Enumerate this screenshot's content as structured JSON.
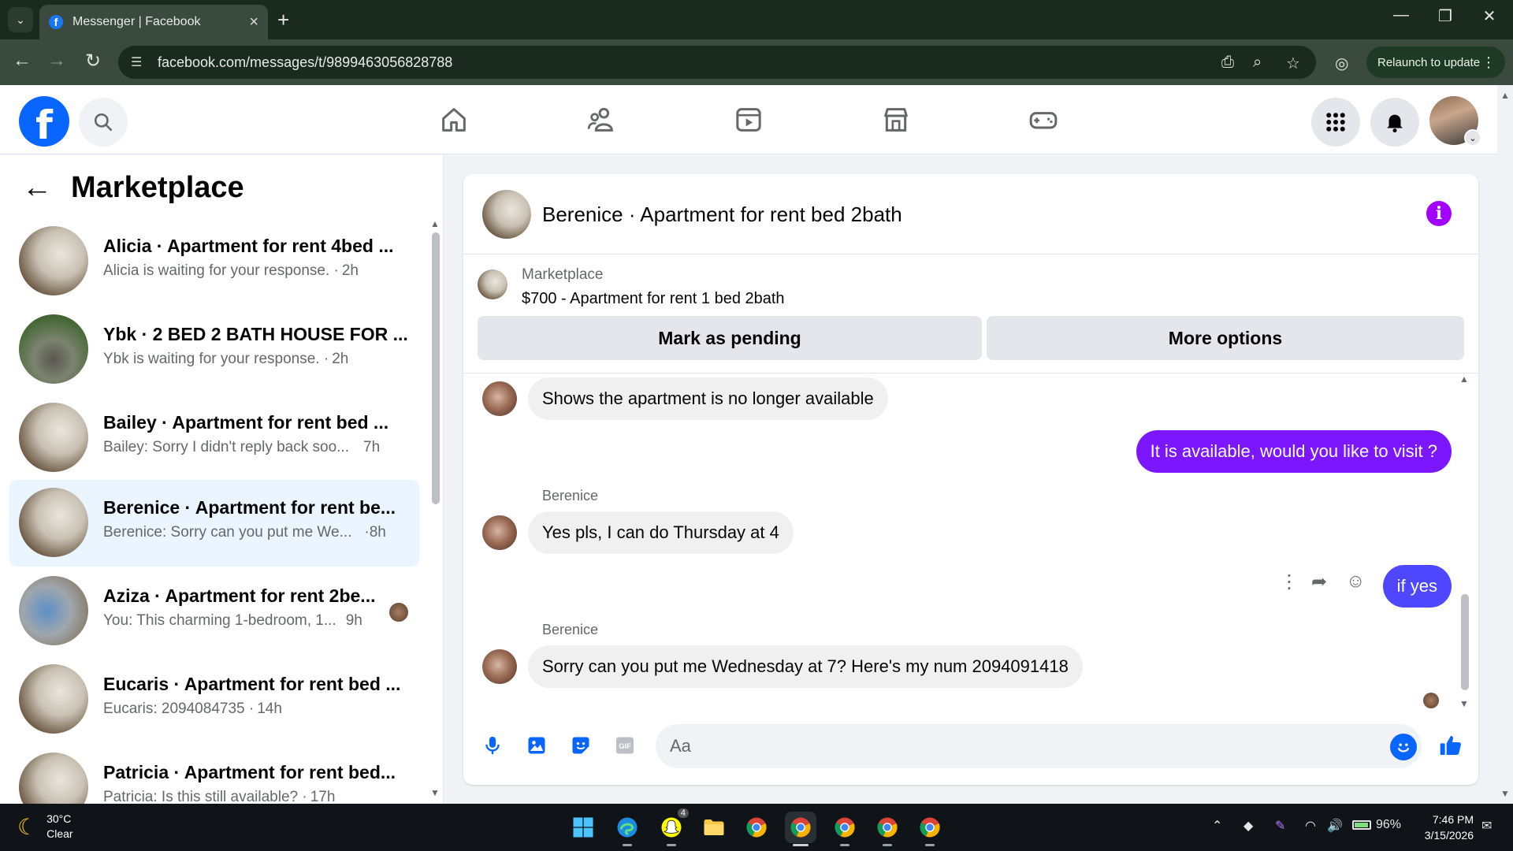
{
  "browser": {
    "tab_title": "Messenger | Facebook",
    "url": "facebook.com/messages/t/9899463056828788",
    "relaunch_label": "Relaunch to update"
  },
  "left_panel": {
    "title": "Marketplace",
    "conversations": [
      {
        "name": "Alicia · Apartment for rent 4bed ...",
        "snippet": "Alicia is waiting for your response. ·",
        "time": "2h"
      },
      {
        "name": "Ybk · 2 BED 2 BATH HOUSE FOR ...",
        "snippet": "Ybk is waiting for your response. ·",
        "time": "2h"
      },
      {
        "name": "Bailey · Apartment for rent bed ...",
        "snippet": "Bailey: Sorry I didn't reply back soo...",
        "time": "7h"
      },
      {
        "name": "Berenice · Apartment for rent be...",
        "snippet": "Berenice: Sorry can you put me We...",
        "time": "·8h"
      },
      {
        "name": "Aziza · Apartment for rent 2be...",
        "snippet": "You: This charming 1-bedroom, 1...",
        "time": "9h"
      },
      {
        "name": "Eucaris · Apartment for rent bed ...",
        "snippet": "Eucaris: 2094084735 ·",
        "time": "14h"
      },
      {
        "name": "Patricia · Apartment for rent bed...",
        "snippet": "Patricia: Is this still available? ·",
        "time": "17h"
      }
    ]
  },
  "chat": {
    "title": "Berenice · Apartment for rent bed 2bath",
    "marketplace_label": "Marketplace",
    "listing": "$700 - Apartment for rent 1 bed 2bath",
    "mark_pending_label": "Mark as pending",
    "more_options_label": "More options",
    "messages": [
      {
        "text": "Shows the apartment is no longer available"
      },
      {
        "text": "It is available, would you like to visit ?"
      },
      {
        "sender": "Berenice",
        "text": "Yes pls, I can do Thursday at 4"
      },
      {
        "text": "if yes"
      },
      {
        "sender": "Berenice",
        "text": "Sorry can you put me Wednesday at 7? Here's my num 2094091418"
      }
    ],
    "composer_placeholder": "Aa"
  },
  "taskbar": {
    "temperature": "30°C",
    "condition": "Clear",
    "snapchat_badge": "4",
    "battery": "96%",
    "time": "7:46 PM",
    "date": "3/15/2026"
  },
  "colors": {
    "facebook_blue": "#0866ff",
    "outgoing_bubble": "#7c16ff",
    "outgoing_bubble_2": "#4f46ff",
    "info_icon": "#a200ff"
  }
}
